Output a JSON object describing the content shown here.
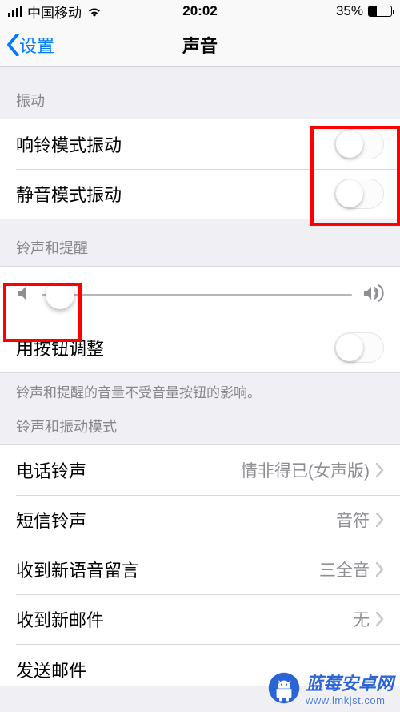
{
  "status_bar": {
    "carrier": "中国移动",
    "time": "20:02",
    "battery_percent": "35%"
  },
  "nav": {
    "back_label": "设置",
    "title": "声音"
  },
  "sections": {
    "vibrate_header": "振动",
    "ring_vibrate": "响铃模式振动",
    "silent_vibrate": "静音模式振动",
    "ringtone_alerts_header": "铃声和提醒",
    "change_with_buttons": "用按钮调整",
    "note": "铃声和提醒的音量不受音量按钮的影响。",
    "sound_patterns_header": "铃声和振动模式",
    "ringtone_label": "电话铃声",
    "ringtone_value": "情非得已(女声版)",
    "text_tone_label": "短信铃声",
    "text_tone_value": "音符",
    "voicemail_label": "收到新语音留言",
    "voicemail_value": "三全音",
    "mail_label": "收到新邮件",
    "mail_value": "无",
    "sent_mail_label": "发送邮件"
  },
  "toggles": {
    "ring_vibrate": false,
    "silent_vibrate": false,
    "change_with_buttons": false
  },
  "slider": {
    "value_percent": 6
  },
  "colors": {
    "tint": "#007aff",
    "annotation": "#ff0000",
    "watermark": "#2a64d6",
    "secondary": "#8e8e93"
  },
  "watermark": {
    "text": "蓝莓安卓网",
    "url": "www.lmkjst.com"
  }
}
